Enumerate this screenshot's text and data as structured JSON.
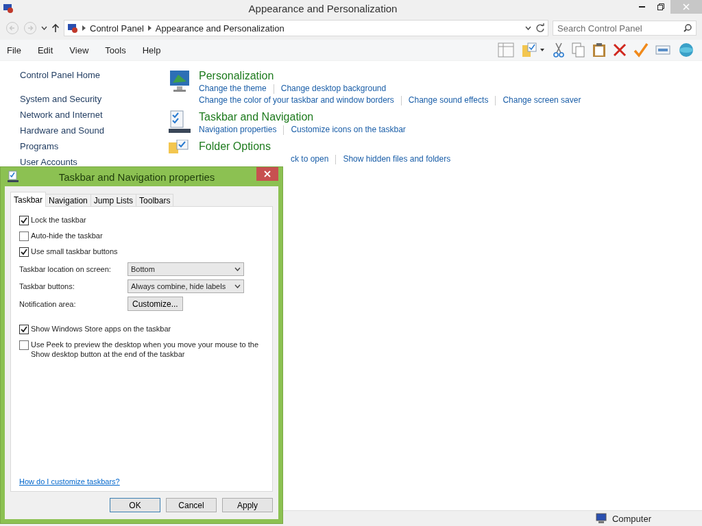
{
  "window": {
    "title": "Appearance and Personalization"
  },
  "address": {
    "crumbs": [
      "Control Panel",
      "Appearance and Personalization"
    ],
    "search_placeholder": "Search Control Panel"
  },
  "menu": [
    "File",
    "Edit",
    "View",
    "Tools",
    "Help"
  ],
  "sidebar": {
    "home": "Control Panel Home",
    "items": [
      "System and Security",
      "Network and Internet",
      "Hardware and Sound",
      "Programs",
      "User Accounts"
    ]
  },
  "sections": [
    {
      "kind": "personalization",
      "title": "Personalization",
      "link_rows": [
        [
          "Change the theme",
          "Change desktop background"
        ],
        [
          "Change the color of your taskbar and window borders",
          "Change sound effects",
          "Change screen saver"
        ]
      ]
    },
    {
      "kind": "taskbar",
      "title": "Taskbar and Navigation",
      "link_rows": [
        [
          "Navigation properties",
          "Customize icons on the taskbar"
        ]
      ]
    },
    {
      "kind": "folder",
      "title": "Folder Options",
      "link_rows": [
        [
          "ck to open",
          "Show hidden files and folders"
        ]
      ]
    }
  ],
  "status_bar": {
    "location": "Computer"
  },
  "dialog": {
    "title": "Taskbar and Navigation properties",
    "tabs": [
      {
        "label": "Taskbar",
        "selected": true
      },
      {
        "label": "Navigation",
        "selected": false
      },
      {
        "label": "Jump Lists",
        "selected": false
      },
      {
        "label": "Toolbars",
        "selected": false
      }
    ],
    "options": [
      {
        "kind": "checkbox",
        "label": "Lock the taskbar",
        "checked": true
      },
      {
        "kind": "checkbox",
        "label": "Auto-hide the taskbar",
        "checked": false
      },
      {
        "kind": "checkbox",
        "label": "Use small taskbar buttons",
        "checked": true
      },
      {
        "kind": "dropdown",
        "label": "Taskbar location on screen:",
        "value": "Bottom"
      },
      {
        "kind": "dropdown",
        "label": "Taskbar buttons:",
        "value": "Always combine, hide labels"
      },
      {
        "kind": "button",
        "label": "Notification area:",
        "value": "Customize..."
      },
      {
        "kind": "checkbox",
        "label": "Show Windows Store apps on the taskbar",
        "checked": true
      },
      {
        "kind": "checkbox",
        "label": "Use Peek to preview the desktop when you move your mouse to the Show desktop button at the end of the taskbar",
        "checked": false
      }
    ],
    "help_link": "How do I customize taskbars?",
    "buttons": [
      "OK",
      "Cancel",
      "Apply"
    ]
  }
}
